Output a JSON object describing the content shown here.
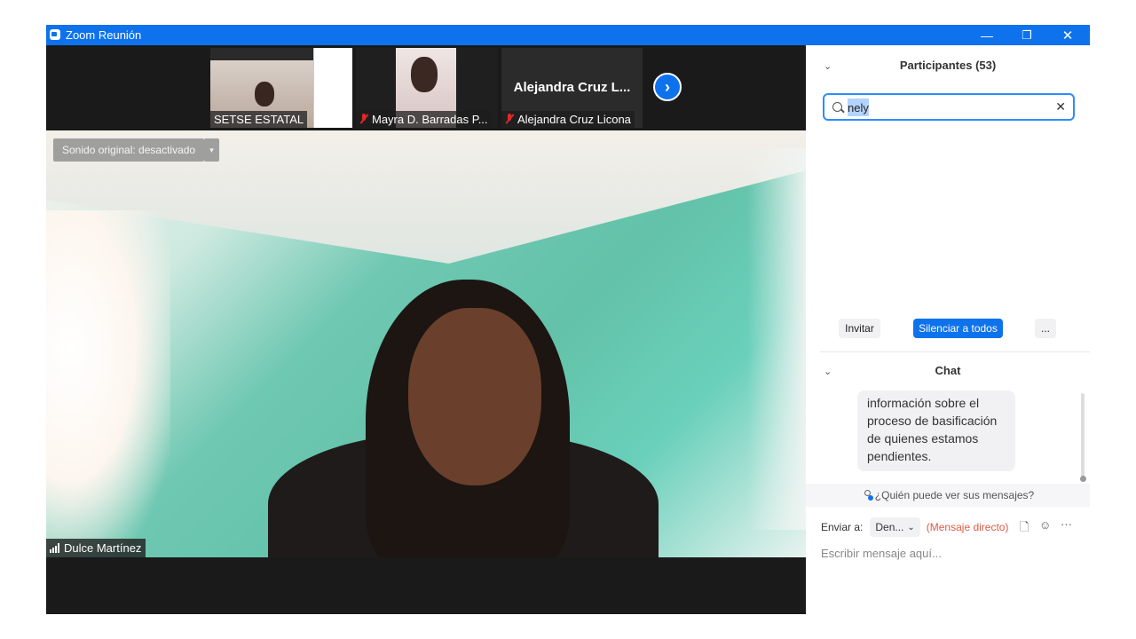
{
  "window": {
    "title": "Zoom Reunión",
    "minimize": "—",
    "restore": "❐",
    "close": "✕"
  },
  "thumbnails": [
    {
      "name": "SETSE ESTATAL",
      "muted": false
    },
    {
      "name": "Mayra D. Barradas P...",
      "muted": true
    },
    {
      "name": "Alejandra Cruz Licona",
      "muted": true,
      "display_name": "Alejandra Cruz L..."
    }
  ],
  "next_arrow": "›",
  "main_video": {
    "sound_button": "Sonido original: desactivado",
    "sound_dropdown": "▾",
    "speaker": "Dulce Martínez"
  },
  "participants": {
    "title": "Participantes (53)",
    "search_value": "nely",
    "clear_icon": "✕",
    "invite": "Invitar",
    "mute_all": "Silenciar a todos",
    "more": "..."
  },
  "chat": {
    "title": "Chat",
    "message": "información sobre el proceso de basificación de quienes estamos pendientes.",
    "who_can_see": "¿Quién puede ver sus mensajes?",
    "send_to_label": "Enviar a:",
    "send_to_value": "Den...",
    "direct_message": "(Mensaje directo)",
    "input_placeholder": "Escribir mensaje aquí..."
  },
  "colors": {
    "accent": "#0e72ed",
    "titlebar": "#0e72ed",
    "muted_mic": "#e02828",
    "direct": "#e05a44"
  }
}
